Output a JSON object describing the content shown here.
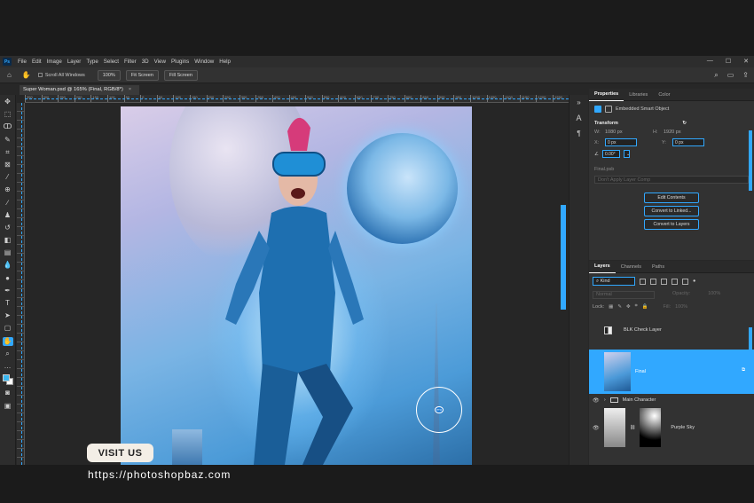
{
  "menubar": {
    "logo": "Ps",
    "items": [
      "File",
      "Edit",
      "Image",
      "Layer",
      "Type",
      "Select",
      "Filter",
      "3D",
      "View",
      "Plugins",
      "Window",
      "Help"
    ]
  },
  "options": {
    "scroll_all": "Scroll All Windows",
    "zoom": "100%",
    "fit_screen": "Fit Screen",
    "fill_screen": "Fill Screen"
  },
  "document": {
    "tab_title": "Super Woman.psd @ 165% (Final, RGB/8*)",
    "ruler_ticks": [
      "350",
      "300",
      "250",
      "200",
      "150",
      "100",
      "50",
      "0",
      "50",
      "100",
      "150",
      "200",
      "250",
      "300",
      "350",
      "400",
      "450",
      "500",
      "550",
      "600",
      "650",
      "700",
      "750",
      "800",
      "850",
      "900",
      "950",
      "1000",
      "1050",
      "1100",
      "1150",
      "1200",
      "1250",
      "1300",
      "1350"
    ],
    "cursor_badge": "PTO"
  },
  "properties": {
    "tabs": [
      "Properties",
      "Libraries",
      "Color"
    ],
    "type_label": "Embedded Smart Object",
    "transform_title": "Transform",
    "w_label": "W:",
    "w_value": "1080 px",
    "h_label": "H:",
    "h_value": "1920 px",
    "x_label": "X:",
    "x_value": "0 px",
    "y_label": "Y:",
    "y_value": "0 px",
    "angle_value": "0.00°",
    "file_name": "Final.psb",
    "layer_comp": "Don't Apply Layer Comp",
    "btn_edit": "Edit Contents",
    "btn_linked": "Convert to Linked...",
    "btn_layers": "Convert to Layers"
  },
  "layers": {
    "tabs": [
      "Layers",
      "Channels",
      "Paths"
    ],
    "kind": "Kind",
    "blend_mode": "Normal",
    "opacity_label": "Opacity:",
    "opacity_value": "100%",
    "lock_label": "Lock:",
    "fill_label": "Fill:",
    "fill_value": "100%",
    "items": [
      {
        "name": "BLK Check Layer"
      },
      {
        "name": "Final"
      },
      {
        "name": "Main Character"
      },
      {
        "name": "Purple Sky"
      }
    ]
  },
  "watermark": {
    "visit": "VISIT US",
    "url": "https://photoshopbaz.com"
  },
  "colors": {
    "accent": "#31a8ff",
    "foreground_swatch": "#39b7f0",
    "background_swatch": "#ffffff"
  }
}
